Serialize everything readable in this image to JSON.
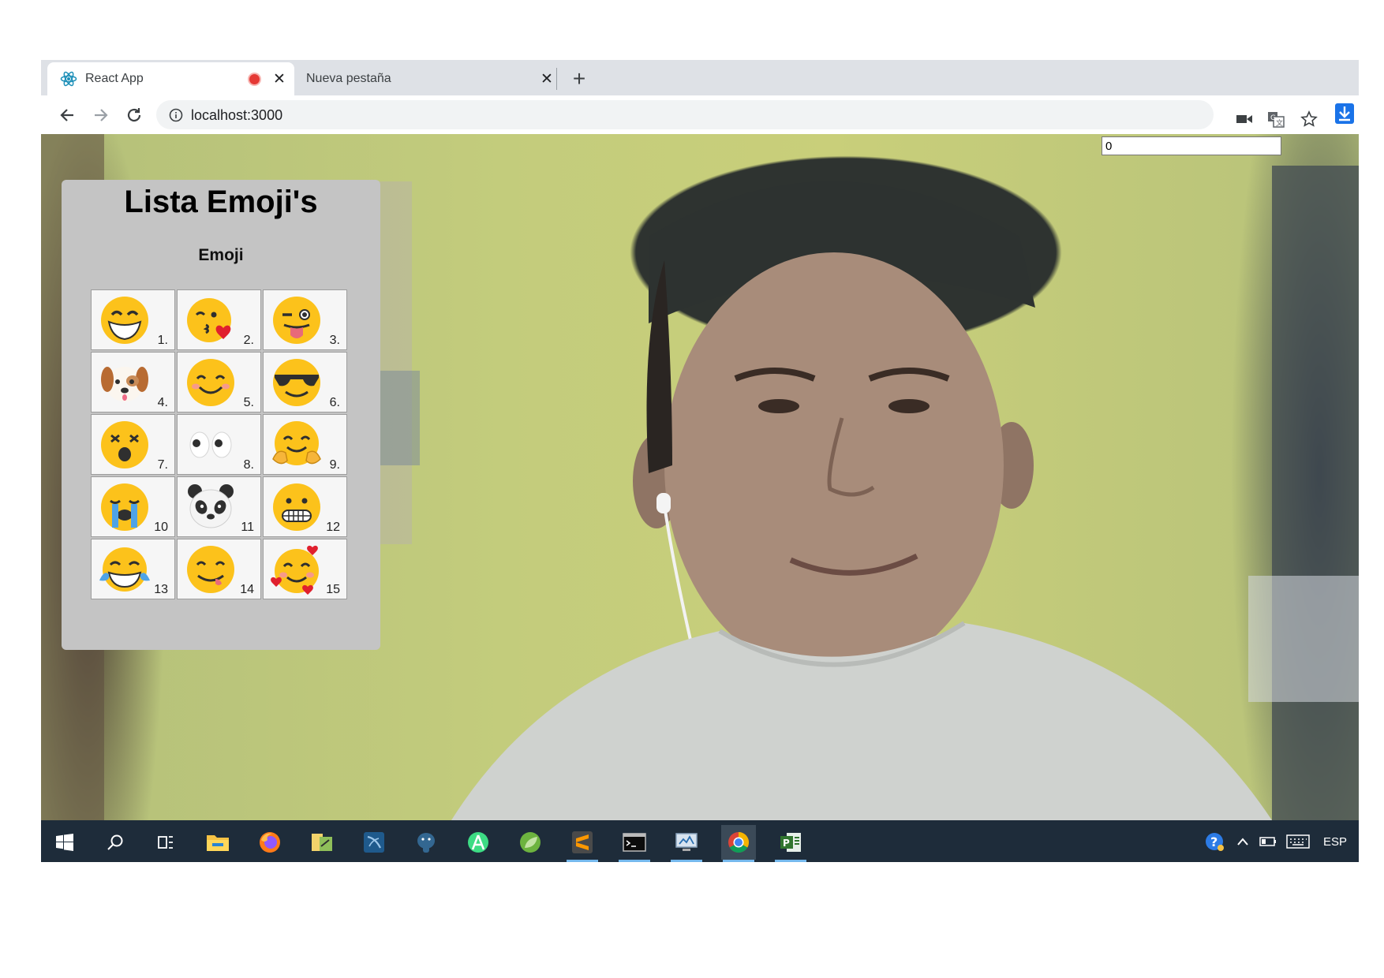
{
  "browser": {
    "tabs": [
      {
        "title": "React App",
        "icon": "react-icon",
        "recording": true
      },
      {
        "title": "Nueva pestaña"
      }
    ],
    "address": "localhost:3000"
  },
  "page": {
    "counter_value": "0",
    "panel_title": "Lista Emoji's",
    "panel_subtitle": "Emoji",
    "emojis": [
      {
        "num": "1.",
        "icon": "grinning-face"
      },
      {
        "num": "2.",
        "icon": "face-blowing-kiss"
      },
      {
        "num": "3.",
        "icon": "winking-face-with-tongue"
      },
      {
        "num": "4.",
        "icon": "dog-face"
      },
      {
        "num": "5.",
        "icon": "smiling-face-with-smiling-eyes"
      },
      {
        "num": "6.",
        "icon": "smiling-face-with-sunglasses"
      },
      {
        "num": "7.",
        "icon": "astonished-face"
      },
      {
        "num": "8.",
        "icon": "eyes"
      },
      {
        "num": "9.",
        "icon": "hugging-face"
      },
      {
        "num": "10",
        "icon": "loudly-crying-face"
      },
      {
        "num": "11",
        "icon": "panda-face"
      },
      {
        "num": "12",
        "icon": "grimacing-face"
      },
      {
        "num": "13",
        "icon": "face-with-tears-of-joy"
      },
      {
        "num": "14",
        "icon": "face-savoring-food"
      },
      {
        "num": "15",
        "icon": "smiling-face-with-hearts"
      }
    ]
  },
  "taskbar": {
    "apps": [
      "start-icon",
      "search-icon",
      "task-view-icon",
      "file-explorer-icon",
      "firefox-icon",
      "app-icon",
      "mysql-workbench-icon",
      "postgresql-icon",
      "android-studio-icon",
      "spring-tools-icon",
      "sublime-text-icon",
      "terminal-icon",
      "remote-desktop-icon",
      "chrome-icon",
      "project-icon"
    ],
    "language": "ESP"
  },
  "colors": {
    "accent": "#1a73e8",
    "panel": "#c4c4c4",
    "taskbar": "#1e2c3a",
    "emoji_yellow": "#fcc21b"
  }
}
